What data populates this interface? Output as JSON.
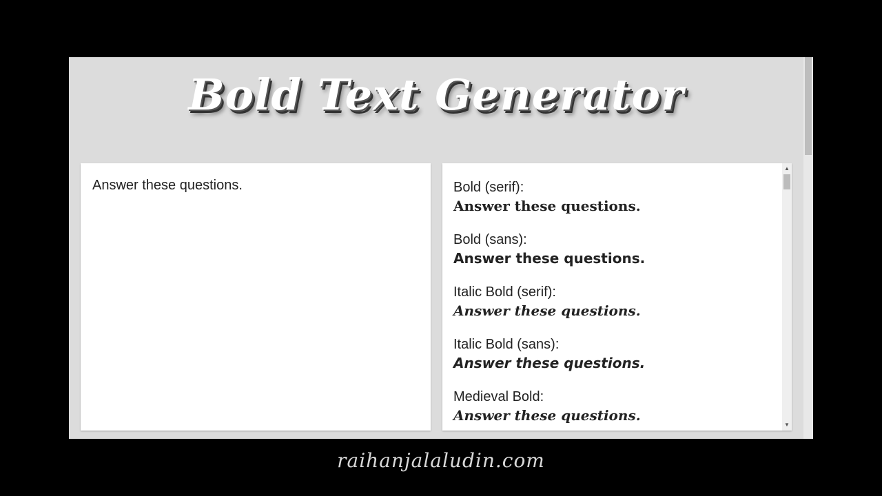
{
  "header": {
    "title": "Bold Text Generator"
  },
  "input": {
    "value": "Answer these questions."
  },
  "output": {
    "results": [
      {
        "label": "Bold (serif):",
        "text": "Answer these questions."
      },
      {
        "label": "Bold (sans):",
        "text": "Answer these questions."
      },
      {
        "label": "Italic Bold (serif):",
        "text": "Answer these questions."
      },
      {
        "label": "Italic Bold (sans):",
        "text": "Answer these questions."
      },
      {
        "label": "Medieval Bold:",
        "text": "Answer these questions."
      }
    ]
  },
  "icons": {
    "scroll_up": "triangle-up-icon",
    "scroll_down": "triangle-down-icon"
  },
  "footer": {
    "watermark": "raihanjalaludin.com"
  }
}
